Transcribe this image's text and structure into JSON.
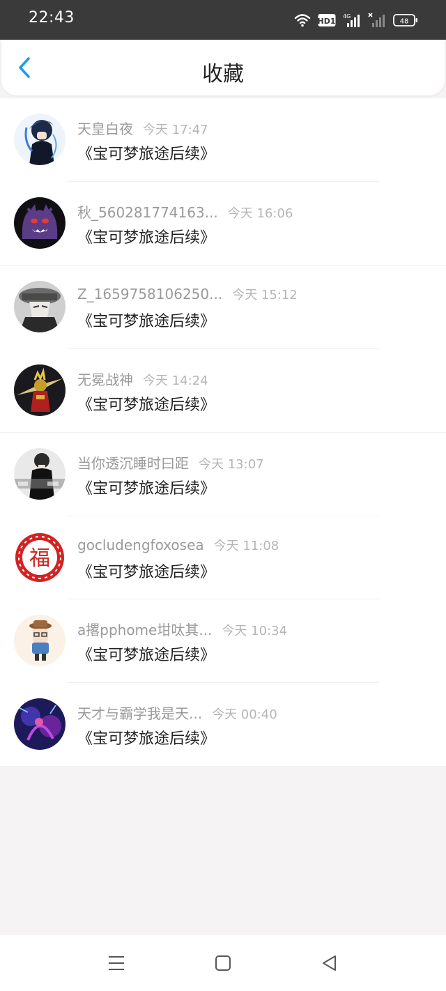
{
  "status_bar": {
    "time": "22:43",
    "hd_label": "HD1",
    "network_label": "4G",
    "battery": "48",
    "icons": [
      "wifi-icon",
      "hd-icon",
      "signal-4g-icon",
      "signal-no-service-icon",
      "battery-icon"
    ]
  },
  "header": {
    "title": "收藏",
    "back_icon": "chevron-left-icon"
  },
  "favorites": [
    {
      "username": "天皇白夜",
      "time": "今天 17:47",
      "title": "《宝可梦旅途后续》"
    },
    {
      "username": "秋_560281774163...",
      "time": "今天 16:06",
      "title": "《宝可梦旅途后续》"
    },
    {
      "username": "Z_1659758106250...",
      "time": "今天 15:12",
      "title": "《宝可梦旅途后续》"
    },
    {
      "username": "无冕战神",
      "time": "今天 14:24",
      "title": "《宝可梦旅途后续》"
    },
    {
      "username": "当你透沉睡时曰距",
      "time": "今天 13:07",
      "title": "《宝可梦旅途后续》"
    },
    {
      "username": "gocludengfoxosea",
      "time": "今天 11:08",
      "title": "《宝可梦旅途后续》"
    },
    {
      "username": "a撂pphome坩呔其...",
      "time": "今天 10:34",
      "title": "《宝可梦旅途后续》"
    },
    {
      "username": "天才与霸学我是天...",
      "time": "今天 00:40",
      "title": "《宝可梦旅途后续》"
    }
  ],
  "nav_bar": {
    "icons": [
      "menu-icon",
      "home-icon",
      "back-triangle-icon"
    ]
  },
  "colors": {
    "accent": "#1e9bf0",
    "status_bar": "#3a3a3a",
    "page_bg": "#f5f3f4"
  }
}
